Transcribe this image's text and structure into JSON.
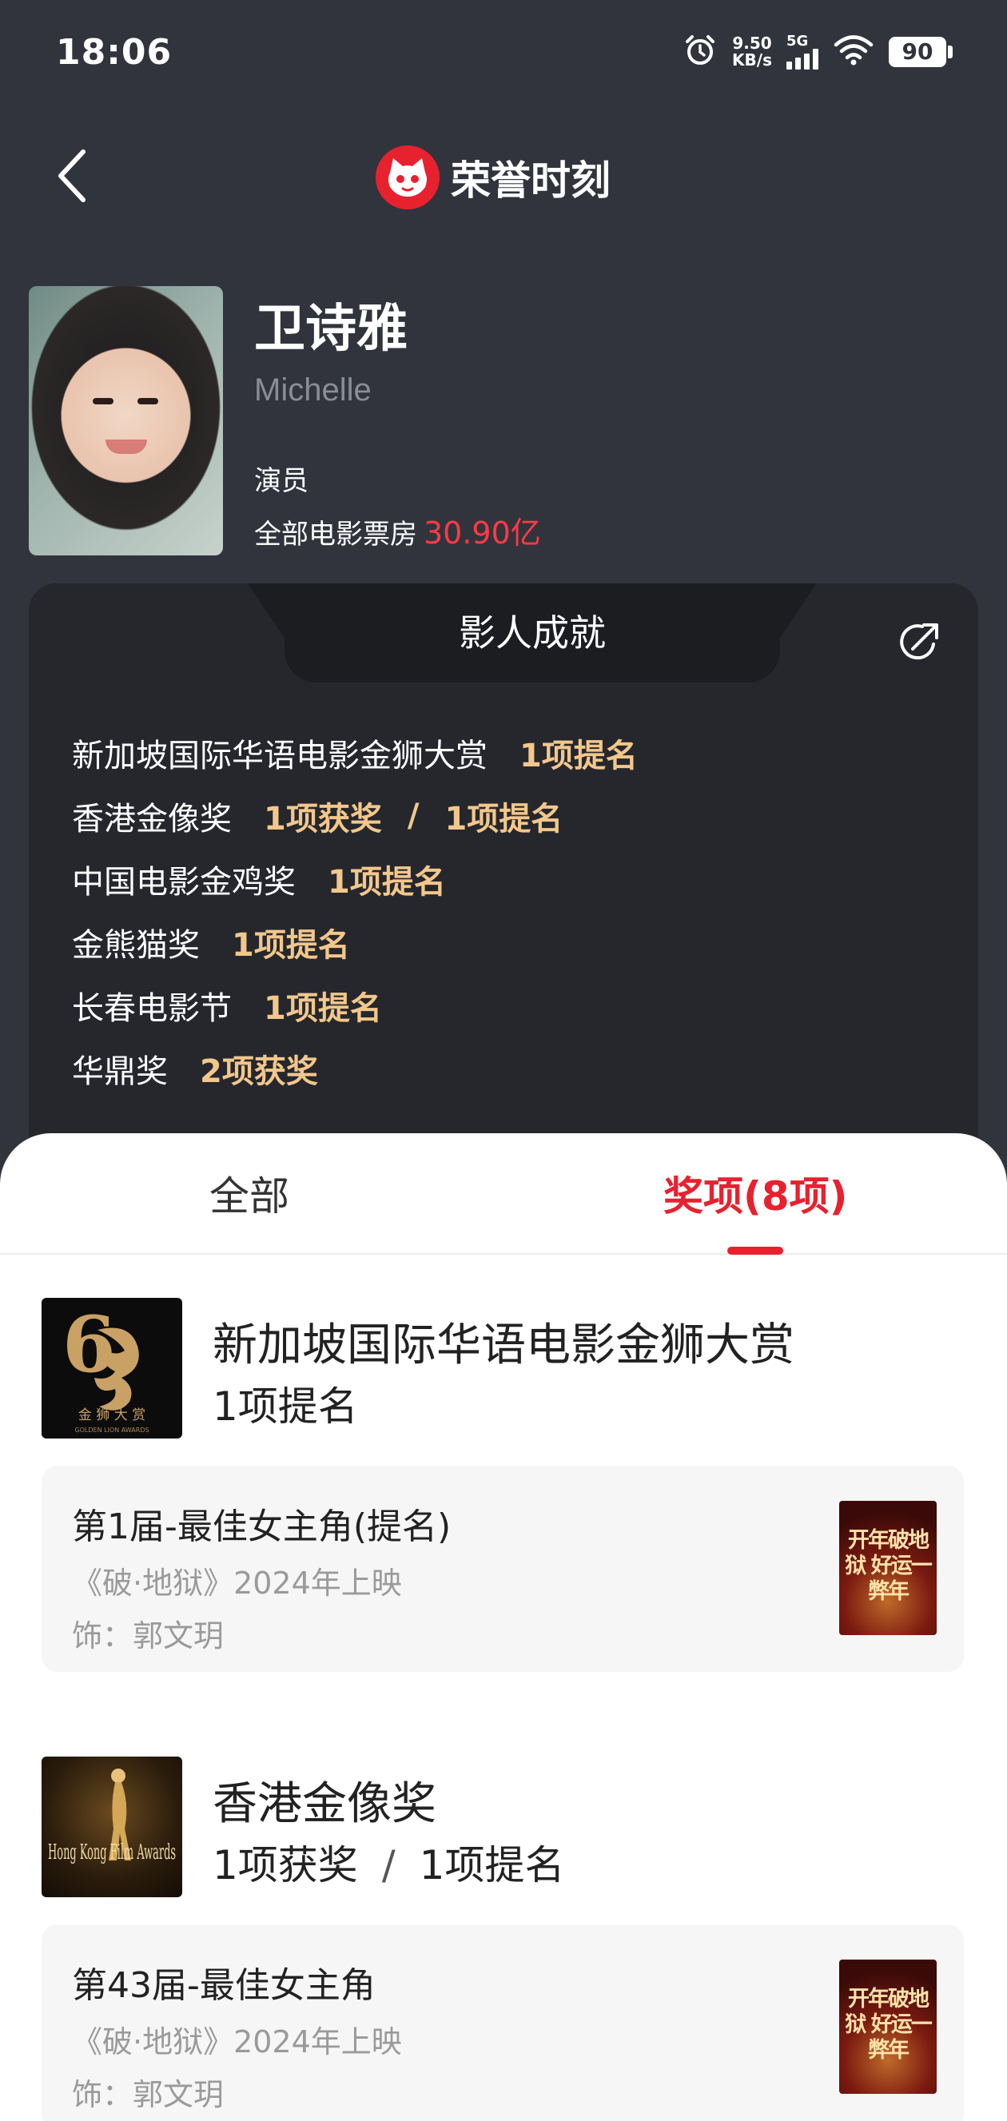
{
  "status_bar": {
    "time": "18:06",
    "net_speed_value": "9.50",
    "net_speed_unit": "KB/s",
    "network": "5G",
    "battery": "90"
  },
  "nav": {
    "title": "荣誉时刻"
  },
  "profile": {
    "name": "卫诗雅",
    "english_name": "Michelle",
    "role": "演员",
    "box_office_label": "全部电影票房",
    "box_office_value": "30.90亿"
  },
  "achievements": {
    "title": "影人成就",
    "items": [
      {
        "name": "新加坡国际华语电影金狮大赏",
        "values": [
          "1项提名"
        ]
      },
      {
        "name": "香港金像奖",
        "values": [
          "1项获奖",
          "1项提名"
        ]
      },
      {
        "name": "中国电影金鸡奖",
        "values": [
          "1项提名"
        ]
      },
      {
        "name": "金熊猫奖",
        "values": [
          "1项提名"
        ]
      },
      {
        "name": "长春电影节",
        "values": [
          "1项提名"
        ]
      },
      {
        "name": "华鼎奖",
        "values": [
          "2项获奖"
        ]
      }
    ],
    "separator": "/"
  },
  "tabs": {
    "all": "全部",
    "awards": "奖项(8项)"
  },
  "awards": [
    {
      "name": "新加坡国际华语电影金狮大赏",
      "summary": [
        "1项提名"
      ],
      "logo_text": "金 狮 大 赏",
      "logo_subtext": "GOLDEN LION AWARDS",
      "entry": {
        "title": "第1届-最佳女主角(提名)",
        "film": "《破·地狱》2024年上映",
        "role": "饰：郭文玥",
        "poster_text": "开年破地狱 好运一弊年"
      }
    },
    {
      "name": "香港金像奖",
      "summary": [
        "1项获奖",
        "1项提名"
      ],
      "logo_text": "Hong Kong Film Awards",
      "entry": {
        "title": "第43届-最佳女主角",
        "film": "《破·地狱》2024年上映",
        "role": "饰：郭文玥",
        "poster_text": "开年破地狱 好运一弊年"
      }
    }
  ],
  "colors": {
    "header_bg": "#31343d",
    "card_bg": "#25272d",
    "accent_red": "#e8212f",
    "gold": "#f3c78b",
    "box_office_red": "#ff3a44"
  }
}
